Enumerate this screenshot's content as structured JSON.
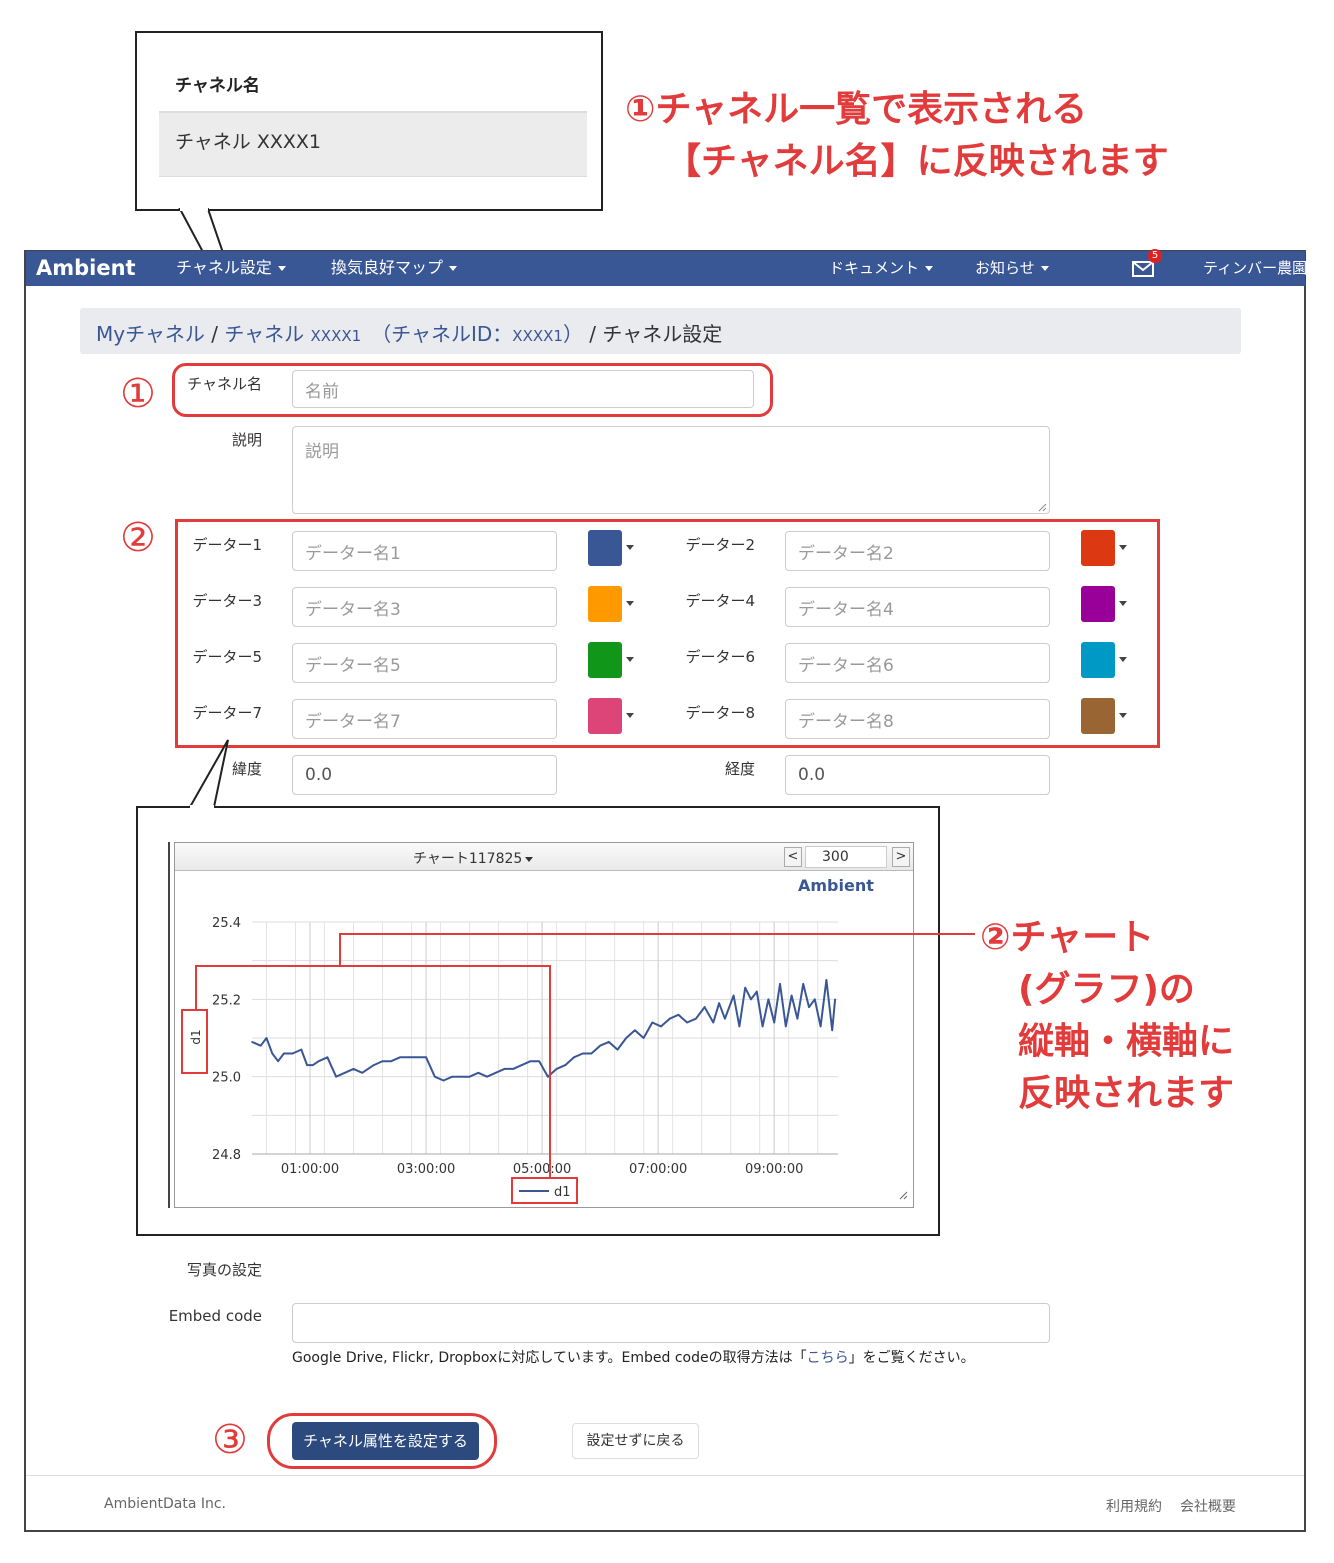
{
  "annotation": {
    "note1_line1": "①チャネル一覧で表示される",
    "note1_line2": "【チャネル名】に反映されます",
    "note2_line1": "②チャート",
    "note2_line2": "(グラフ)の",
    "note2_line3": "縦軸・横軸に",
    "note2_line4": "反映されます",
    "marker1": "①",
    "marker2": "②",
    "marker3": "③",
    "callout_table_header": "チャネル名",
    "callout_table_row": "チャネル XXXX1"
  },
  "navbar": {
    "brand": "Ambient",
    "channel_settings": "チャネル設定",
    "ventilation_map": "換気良好マップ",
    "documents": "ドキュメント",
    "news": "お知らせ",
    "mail_badge": "5",
    "user": "ティンバー農園"
  },
  "breadcrumb": {
    "my_channels": "Myチャネル",
    "sep1": " / ",
    "channel_prefix": "チャネル ",
    "channel_id": "XXXX1",
    "id_open": "（チャネルID：",
    "id_value": "XXXX1",
    "id_close": "）",
    "sep2": " / ",
    "current": "チャネル設定"
  },
  "form": {
    "name_label": "チャネル名",
    "name_placeholder": "名前",
    "desc_label": "説明",
    "desc_placeholder": "説明",
    "data_fields": [
      {
        "label": "データー1",
        "placeholder": "データー名1",
        "color": "#3a5795"
      },
      {
        "label": "データー2",
        "placeholder": "データー名2",
        "color": "#dc3912"
      },
      {
        "label": "データー3",
        "placeholder": "データー名3",
        "color": "#ff9900"
      },
      {
        "label": "データー4",
        "placeholder": "データー名4",
        "color": "#990099"
      },
      {
        "label": "データー5",
        "placeholder": "データー名5",
        "color": "#109618"
      },
      {
        "label": "データー6",
        "placeholder": "データー名6",
        "color": "#0099c6"
      },
      {
        "label": "データー7",
        "placeholder": "データー名7",
        "color": "#dd4477"
      },
      {
        "label": "データー8",
        "placeholder": "データー名8",
        "color": "#996633"
      }
    ],
    "lat_label": "緯度",
    "lat_value": "0.0",
    "lng_label": "経度",
    "lng_value": "0.0",
    "photo_label": "写真の設定",
    "embed_label": "Embed code",
    "embed_help": "Google Drive, Flickr, Dropboxに対応しています。Embed codeの取得方法は「",
    "embed_link": "こちら",
    "embed_help_end": "」をご覧ください。",
    "submit": "チャネル属性を設定する",
    "cancel": "設定せずに戻る"
  },
  "chart_panel": {
    "title": "チャート117825",
    "count": "300",
    "prev": "<",
    "next": ">",
    "watermark": "Ambient"
  },
  "chart_data": {
    "type": "line",
    "ylabel": "d1",
    "ylim": [
      24.8,
      25.4
    ],
    "yticks": [
      "25.4",
      "25.2",
      "25.0",
      "24.8"
    ],
    "xticks": [
      "01:00:00",
      "03:00:00",
      "05:00:00",
      "07:00:00",
      "09:00:00"
    ],
    "xrange_hours": [
      0,
      10.1
    ],
    "series": [
      {
        "name": "d1",
        "color": "#3a5795",
        "x": [
          0.0,
          0.15,
          0.25,
          0.35,
          0.45,
          0.55,
          0.7,
          0.85,
          0.95,
          1.05,
          1.15,
          1.3,
          1.45,
          1.6,
          1.75,
          1.9,
          2.0,
          2.1,
          2.25,
          2.4,
          2.55,
          2.7,
          2.85,
          3.0,
          3.15,
          3.3,
          3.45,
          3.6,
          3.75,
          3.9,
          4.05,
          4.2,
          4.35,
          4.5,
          4.65,
          4.8,
          4.95,
          5.1,
          5.25,
          5.4,
          5.55,
          5.7,
          5.85,
          6.0,
          6.15,
          6.3,
          6.45,
          6.6,
          6.75,
          6.9,
          7.05,
          7.2,
          7.35,
          7.5,
          7.65,
          7.8,
          7.95,
          8.05,
          8.15,
          8.3,
          8.4,
          8.5,
          8.6,
          8.7,
          8.8,
          8.9,
          9.0,
          9.1,
          9.2,
          9.3,
          9.4,
          9.5,
          9.6,
          9.7,
          9.8,
          9.9,
          10.0,
          10.05
        ],
        "values": [
          25.09,
          25.08,
          25.1,
          25.06,
          25.04,
          25.06,
          25.06,
          25.07,
          25.03,
          25.03,
          25.04,
          25.05,
          25.0,
          25.01,
          25.02,
          25.01,
          25.02,
          25.03,
          25.04,
          25.04,
          25.05,
          25.05,
          25.05,
          25.05,
          25.0,
          24.99,
          25.0,
          25.0,
          25.0,
          25.01,
          25.0,
          25.01,
          25.02,
          25.02,
          25.03,
          25.04,
          25.04,
          25.0,
          25.02,
          25.03,
          25.05,
          25.06,
          25.06,
          25.08,
          25.09,
          25.07,
          25.1,
          25.12,
          25.1,
          25.14,
          25.13,
          25.15,
          25.16,
          25.14,
          25.15,
          25.18,
          25.14,
          25.19,
          25.15,
          25.21,
          25.13,
          25.23,
          25.2,
          25.22,
          25.13,
          25.2,
          25.14,
          25.24,
          25.13,
          25.21,
          25.15,
          25.24,
          25.18,
          25.2,
          25.13,
          25.25,
          25.12,
          25.2
        ]
      }
    ],
    "legend": "bottom-center",
    "grid": true
  },
  "footer": {
    "company": "AmbientData Inc.",
    "terms": "利用規約",
    "about": "会社概要"
  },
  "colors": {
    "navbar": "#3a5795",
    "annotation": "#e23b3b",
    "primary_button": "#2c4a7e"
  }
}
